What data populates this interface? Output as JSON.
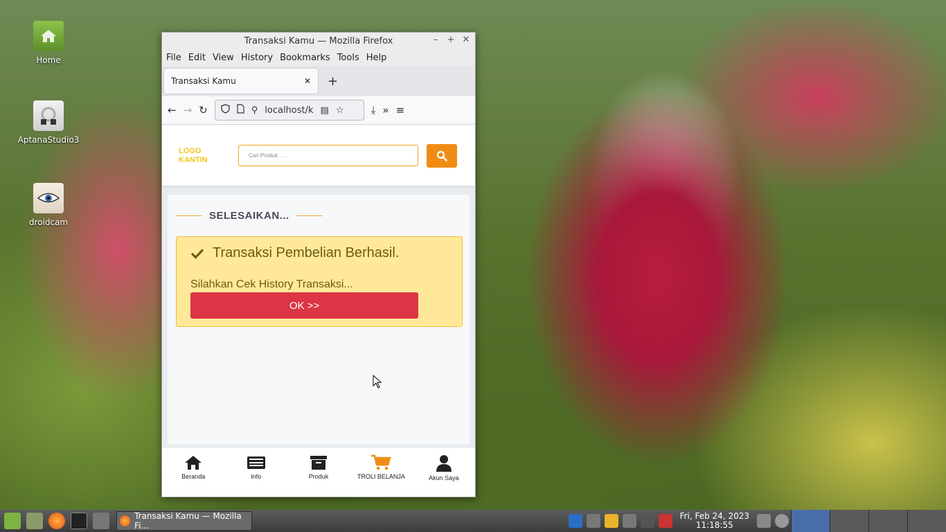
{
  "desktop": {
    "icons": [
      {
        "label": "Home",
        "icon": "folder-home-icon"
      },
      {
        "label": "AptanaStudio3",
        "icon": "aptana-icon"
      },
      {
        "label": "droidcam",
        "icon": "droidcam-icon"
      }
    ]
  },
  "window": {
    "title": "Transaksi Kamu — Mozilla Firefox",
    "menu": [
      "File",
      "Edit",
      "View",
      "History",
      "Bookmarks",
      "Tools",
      "Help"
    ],
    "tab_title": "Transaksi Kamu",
    "url": "localhost/k"
  },
  "page": {
    "logo_line1": "LOGO",
    "logo_line2": "KANTIN",
    "search_placeholder": "Cari Produk . . .",
    "section_title": "SELESAIKAN...",
    "alert_title": "Transaksi Pembelian Berhasil.",
    "alert_sub": "Silahkan Cek History Transaksi...",
    "ok_label": "OK >>",
    "accent_color": "#f08c14",
    "nav": [
      {
        "label": "Beranda",
        "icon": "home-icon"
      },
      {
        "label": "Info",
        "icon": "newspaper-icon"
      },
      {
        "label": "Produk",
        "icon": "box-icon"
      },
      {
        "label": "TROLI BELANJA",
        "icon": "cart-icon",
        "active": true
      },
      {
        "label": "Akun Saya",
        "icon": "user-icon"
      }
    ]
  },
  "taskbar": {
    "task_label": "Transaksi Kamu — Mozilla Fi...",
    "clock_date": "Fri, Feb 24, 2023",
    "clock_time": "11:18:55"
  }
}
